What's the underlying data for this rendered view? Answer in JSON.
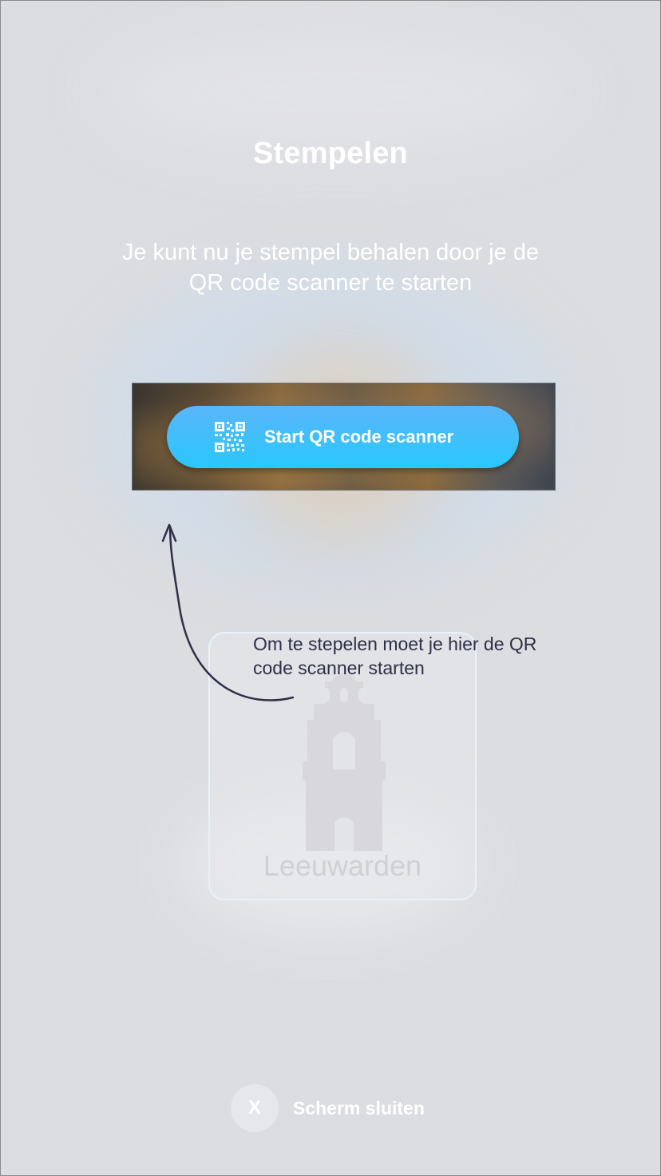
{
  "screen": {
    "title": "Stempelen",
    "subtitle": "Je kunt nu je stempel behalen door je de QR code scanner te starten"
  },
  "scanner": {
    "button_label": "Start QR code scanner",
    "icon": "qr-code-icon"
  },
  "stamp": {
    "location": "Leeuwarden",
    "icon": "tower-icon"
  },
  "annotation": {
    "text": "Om te stepelen moet je hier de QR code scanner starten"
  },
  "footer": {
    "close_icon_text": "X",
    "close_label": "Scherm sluiten"
  },
  "colors": {
    "button_gradient_top": "#5ab6fb",
    "button_gradient_bottom": "#28c8fb",
    "annotation_text": "#2e2f45",
    "background": "#dcdde0"
  }
}
